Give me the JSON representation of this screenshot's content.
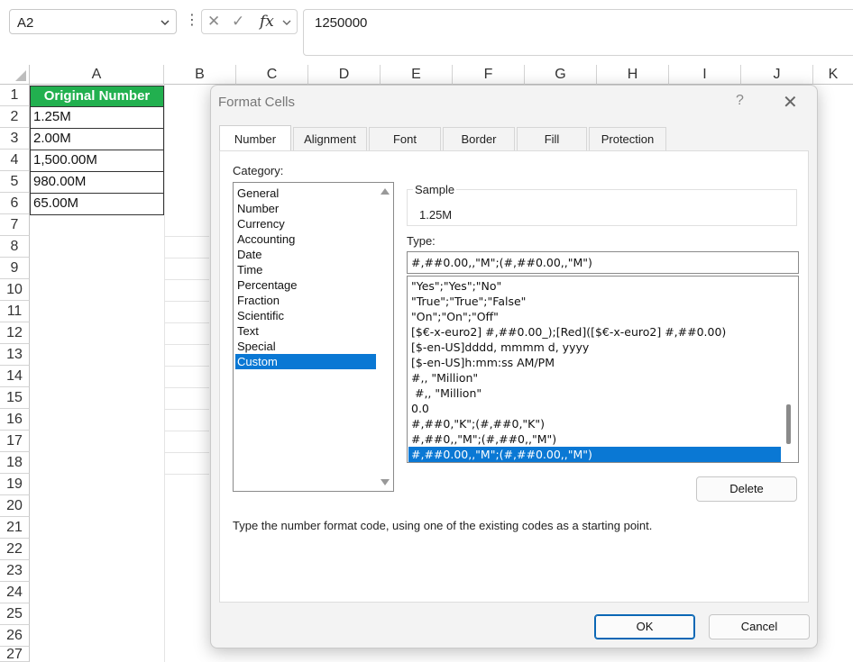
{
  "formula_bar": {
    "name_box": "A2",
    "fx_label": "fx",
    "formula_value": "1250000"
  },
  "sheet": {
    "columns": [
      "A",
      "B",
      "C",
      "D",
      "E",
      "F",
      "G",
      "H",
      "I",
      "J",
      "K"
    ],
    "rows": [
      "1",
      "2",
      "3",
      "4",
      "5",
      "6",
      "7",
      "8",
      "9",
      "10",
      "11",
      "12",
      "13",
      "14",
      "15",
      "16",
      "17",
      "18",
      "19",
      "20",
      "21",
      "22",
      "23",
      "24",
      "25",
      "26",
      "27"
    ],
    "cells": [
      "Original Number",
      "1.25M",
      "2.00M",
      "1,500.00M",
      "980.00M",
      "65.00M"
    ],
    "header_color": "#22b04f"
  },
  "dialog": {
    "title": "Format Cells",
    "help": "?",
    "close": "✕",
    "tabs": [
      "Number",
      "Alignment",
      "Font",
      "Border",
      "Fill",
      "Protection"
    ],
    "category_label": "Category:",
    "categories": [
      "General",
      "Number",
      "Currency",
      "Accounting",
      "Date",
      "Time",
      "Percentage",
      "Fraction",
      "Scientific",
      "Text",
      "Special",
      "Custom"
    ],
    "selected_category": "Custom",
    "sample_label": "Sample",
    "sample_value": "1.25M",
    "type_label": "Type:",
    "type_value": "#,##0.00,,\"M\";(#,##0.00,,\"M\")",
    "formats": [
      "\"Yes\";\"Yes\";\"No\"",
      "\"True\";\"True\";\"False\"",
      "\"On\";\"On\";\"Off\"",
      "[$€-x-euro2] #,##0.00_);[Red]([$€-x-euro2] #,##0.00)",
      "[$-en-US]dddd, mmmm d, yyyy",
      "[$-en-US]h:mm:ss AM/PM",
      "#,, \"Million\"",
      " #,, \"Million\"",
      "0.0",
      "#,##0,\"K\";(#,##0,\"K\")",
      "#,##0,,\"M\";(#,##0,,\"M\")",
      "#,##0.00,,\"M\";(#,##0.00,,\"M\")"
    ],
    "delete_label": "Delete",
    "description": "Type the number format code, using one of the existing codes as a starting point.",
    "ok_label": "OK",
    "cancel_label": "Cancel",
    "accent_color": "#0a78d4"
  }
}
